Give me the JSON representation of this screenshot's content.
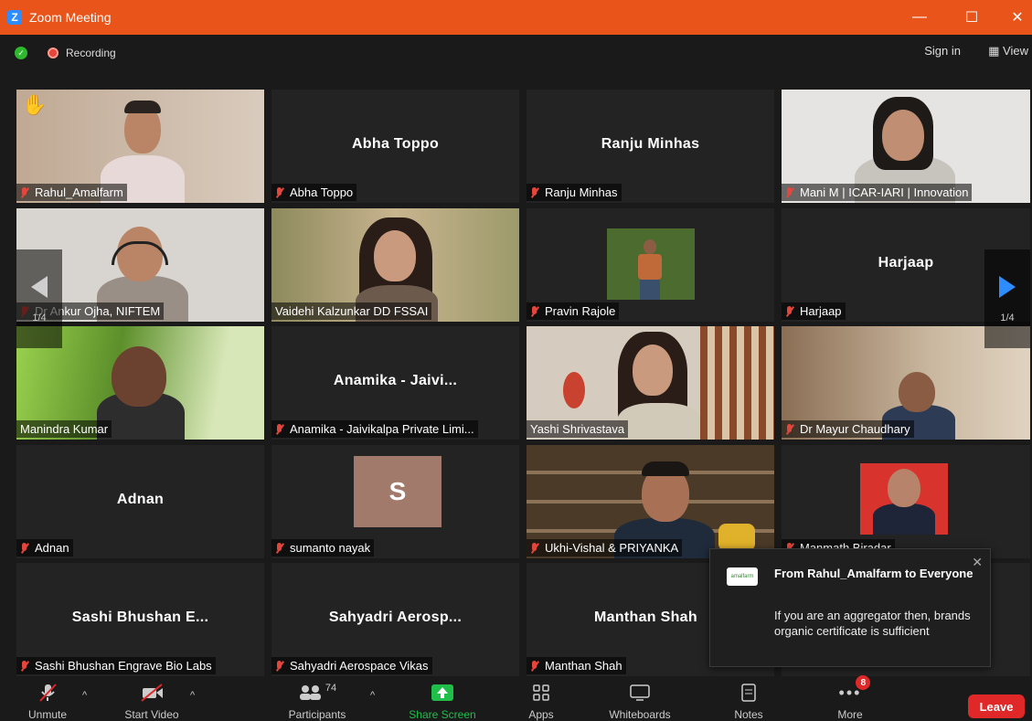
{
  "window": {
    "app_letter": "Z",
    "title": "Zoom Meeting",
    "min": "—",
    "max": "☐",
    "close": "✕"
  },
  "status": {
    "recording": "Recording",
    "sign_in": "Sign in",
    "view": "View"
  },
  "tiles": [
    {
      "name": "Rahul_Amalfarm",
      "big": "",
      "muted": true
    },
    {
      "name": "Abha Toppo",
      "big": "Abha Toppo",
      "muted": true
    },
    {
      "name": "Ranju Minhas",
      "big": "Ranju Minhas",
      "muted": true
    },
    {
      "name": "Mani M | ICAR-IARI | Innovation",
      "big": "",
      "muted": true
    },
    {
      "name": "Dr Ankur Ojha, NIFTEM",
      "big": "",
      "muted": true
    },
    {
      "name": "Vaidehi Kalzunkar DD FSSAI",
      "big": "",
      "muted": false
    },
    {
      "name": "Pravin Rajole",
      "big": "",
      "muted": true
    },
    {
      "name": "Harjaap",
      "big": "Harjaap",
      "muted": true
    },
    {
      "name": "Manindra Kumar",
      "big": "",
      "muted": false
    },
    {
      "name": "Anamika - Jaivikalpa Private Limi...",
      "big": "Anamika - Jaivi...",
      "muted": true
    },
    {
      "name": "Yashi Shrivastava",
      "big": "",
      "muted": false
    },
    {
      "name": "Dr Mayur Chaudhary",
      "big": "",
      "muted": true
    },
    {
      "name": "Adnan",
      "big": "Adnan",
      "muted": true
    },
    {
      "name": "sumanto nayak",
      "big": "",
      "muted": true,
      "avatar": "S"
    },
    {
      "name": "Ukhi-Vishal & PRIYANKA",
      "big": "",
      "muted": true
    },
    {
      "name": "Manmath Biradar",
      "big": "",
      "muted": true
    },
    {
      "name": "Sashi Bhushan Engrave Bio Labs",
      "big": "Sashi Bhushan E...",
      "muted": true
    },
    {
      "name": "Sahyadri Aerospace Vikas",
      "big": "Sahyadri  Aerosp...",
      "muted": true
    },
    {
      "name": "Manthan Shah",
      "big": "Manthan Shah",
      "muted": true
    }
  ],
  "pager": {
    "left": "1/4",
    "right": "1/4"
  },
  "chat": {
    "logo": "amalfarm",
    "from": "From Rahul_Amalfarm to Everyone",
    "message": "If you are an aggregator then, brands organic certificate is sufficient",
    "close": "✕"
  },
  "toolbar": {
    "unmute": "Unmute",
    "start_video": "Start Video",
    "participants": "Participants",
    "participants_count": "74",
    "share_screen": "Share Screen",
    "apps": "Apps",
    "whiteboards": "Whiteboards",
    "notes": "Notes",
    "more": "More",
    "more_badge": "8",
    "leave": "Leave",
    "caret": "^"
  },
  "colors": {
    "title_bar": "#e8541a",
    "share_green": "#1fbf4a",
    "leave_red": "#e02828",
    "active_outline": "#ece38c"
  }
}
